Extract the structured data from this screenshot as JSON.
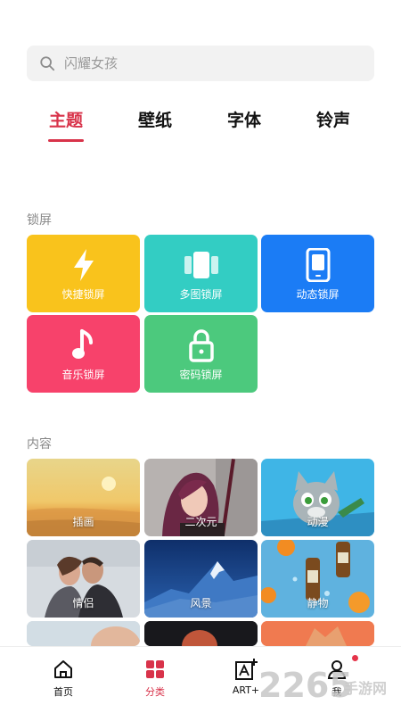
{
  "search": {
    "placeholder": "闪耀女孩"
  },
  "tabs": [
    {
      "label": "主题",
      "active": true
    },
    {
      "label": "壁纸",
      "active": false
    },
    {
      "label": "字体",
      "active": false
    },
    {
      "label": "铃声",
      "active": false
    }
  ],
  "lock_section": {
    "title": "锁屏",
    "tiles": [
      {
        "label": "快捷锁屏",
        "color": "#f9c31c",
        "icon": "lightning-icon"
      },
      {
        "label": "多图锁屏",
        "color": "#33cdc3",
        "icon": "multi-image-icon"
      },
      {
        "label": "动态锁屏",
        "color": "#1b7cf5",
        "icon": "phone-icon"
      },
      {
        "label": "音乐锁屏",
        "color": "#f7426b",
        "icon": "music-note-icon"
      },
      {
        "label": "密码锁屏",
        "color": "#4cc97d",
        "icon": "lock-icon"
      }
    ]
  },
  "content_section": {
    "title": "内容",
    "tiles": [
      {
        "label": "插画"
      },
      {
        "label": "二次元"
      },
      {
        "label": "动漫"
      },
      {
        "label": "情侣"
      },
      {
        "label": "风景"
      },
      {
        "label": "静物"
      }
    ]
  },
  "bottom_nav": [
    {
      "label": "首页",
      "icon": "home-icon",
      "active": false
    },
    {
      "label": "分类",
      "icon": "grid-icon",
      "active": true
    },
    {
      "label": "ART+",
      "icon": "art-plus-icon",
      "active": false
    },
    {
      "label": "我",
      "icon": "user-icon",
      "active": false
    }
  ],
  "watermark": {
    "number": "2265",
    "suffix": "手游网"
  },
  "colors": {
    "accent": "#d8334a"
  }
}
